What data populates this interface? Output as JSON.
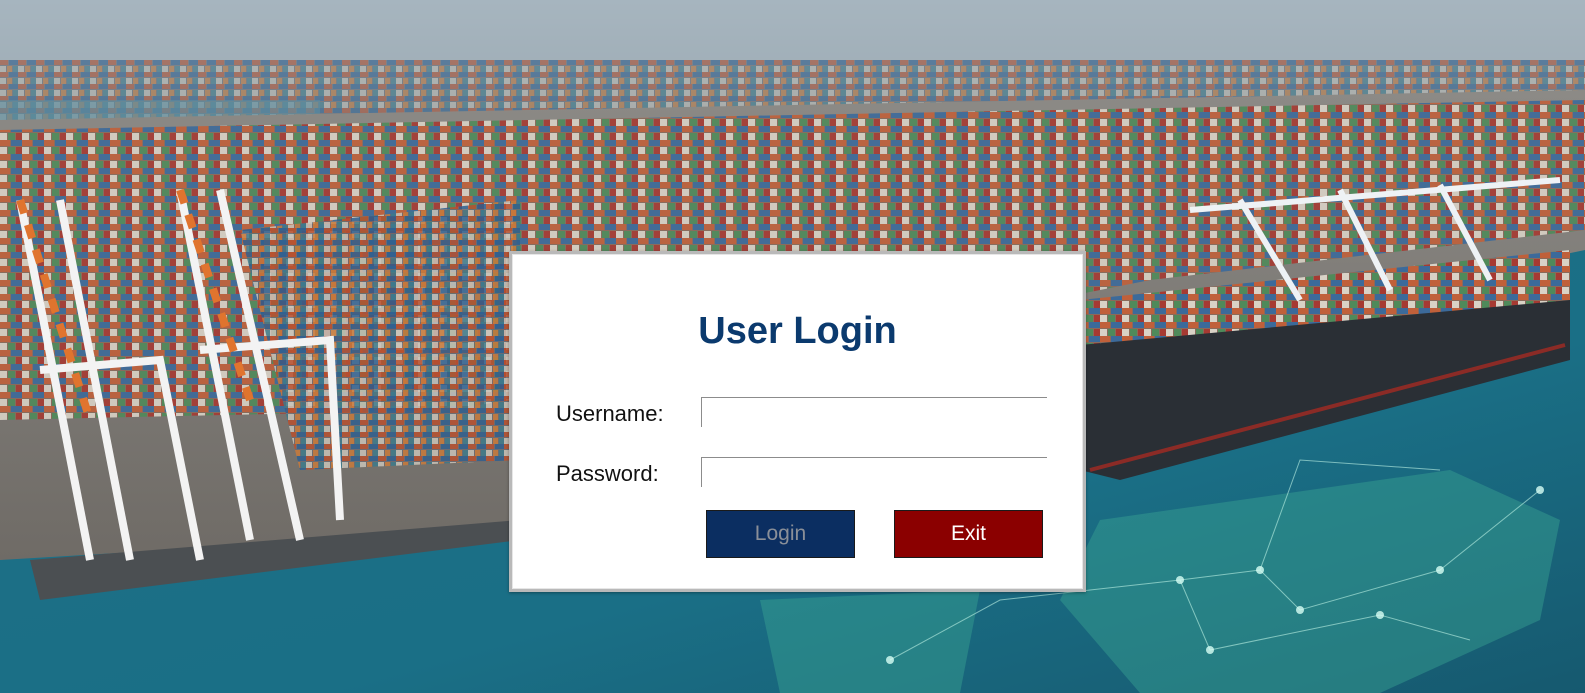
{
  "login_dialog": {
    "title": "User Login",
    "username_label": "Username:",
    "password_label": "Password:",
    "username_value": "",
    "password_value": "",
    "login_label": "Login",
    "exit_label": "Exit"
  },
  "colors": {
    "title": "#0b3a6e",
    "login_button": "#0b2e61",
    "login_text_disabled": "#8a8f98",
    "exit_button": "#8b0000",
    "exit_text": "#ffffff"
  },
  "background": {
    "subject": "container-port-harbor-photo"
  }
}
